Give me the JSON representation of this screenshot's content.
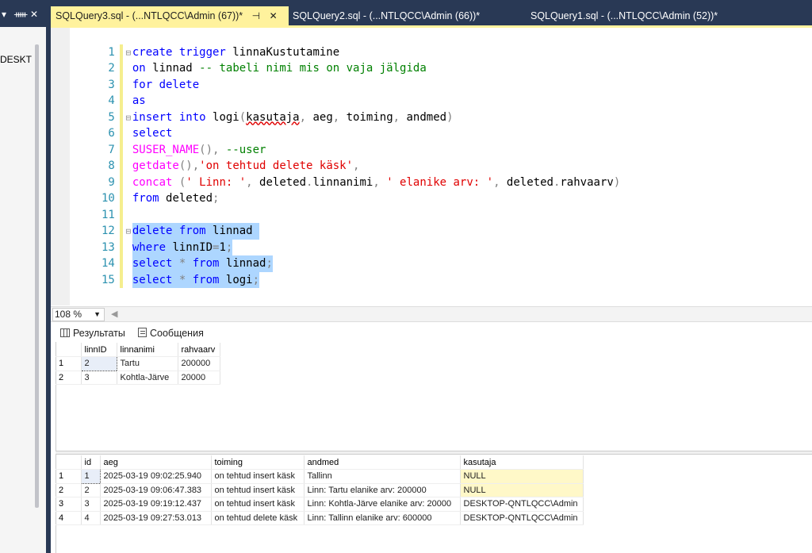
{
  "left_panel": {
    "header_icons": [
      "chevron-down",
      "pin",
      "close"
    ],
    "item": "DESKTO"
  },
  "tabs": [
    {
      "label": "SQLQuery3.sql - (...NTLQCC\\Admin (67))*",
      "active": true
    },
    {
      "label": "SQLQuery2.sql - (...NTLQCC\\Admin (66))*",
      "active": false
    },
    {
      "label": "SQLQuery1.sql - (...NTLQCC\\Admin (52))*",
      "active": false
    }
  ],
  "editor": {
    "lines": [
      {
        "n": "1",
        "fold": true,
        "text": "create trigger linnaKustutamine"
      },
      {
        "n": "2",
        "fold": false,
        "text": "on linnad -- tabeli nimi mis on vaja jälgida"
      },
      {
        "n": "3",
        "fold": false,
        "text": "for delete"
      },
      {
        "n": "4",
        "fold": false,
        "text": "as"
      },
      {
        "n": "5",
        "fold": true,
        "text": "insert into logi(kasutaja, aeg, toiming, andmed)"
      },
      {
        "n": "6",
        "fold": false,
        "text": "select"
      },
      {
        "n": "7",
        "fold": false,
        "text": "SUSER_NAME(), --user"
      },
      {
        "n": "8",
        "fold": false,
        "text": "getdate(),'on tehtud delete käsk',"
      },
      {
        "n": "9",
        "fold": false,
        "text": "concat (' Linn: ', deleted.linnanimi, ' elanike arv: ', deleted.rahvaarv)"
      },
      {
        "n": "10",
        "fold": false,
        "text": "from deleted;"
      },
      {
        "n": "11",
        "fold": false,
        "text": ""
      },
      {
        "n": "12",
        "fold": true,
        "text": "delete from linnad"
      },
      {
        "n": "13",
        "fold": false,
        "text": "where linnID=1;"
      },
      {
        "n": "14",
        "fold": false,
        "text": "select * from linnad;"
      },
      {
        "n": "15",
        "fold": false,
        "text": "select * from logi;"
      }
    ]
  },
  "zoom": {
    "value": "108 %"
  },
  "results_tabs": {
    "results": "Результаты",
    "messages": "Сообщения"
  },
  "grid1": {
    "columns": [
      "linnID",
      "linnanimi",
      "rahvaarv"
    ],
    "rows": [
      {
        "rn": "1",
        "cells": [
          "2",
          "Tartu",
          "200000"
        ]
      },
      {
        "rn": "2",
        "cells": [
          "3",
          "Kohtla-Järve",
          "20000"
        ]
      }
    ]
  },
  "grid2": {
    "columns": [
      "id",
      "aeg",
      "toiming",
      "andmed",
      "kasutaja"
    ],
    "rows": [
      {
        "rn": "1",
        "cells": [
          "1",
          "2025-03-19 09:02:25.940",
          "on tehtud insert käsk",
          "Tallinn",
          "NULL"
        ]
      },
      {
        "rn": "2",
        "cells": [
          "2",
          "2025-03-19 09:06:47.383",
          "on tehtud insert käsk",
          " Linn: Tartu elanike arv: 200000",
          "NULL"
        ]
      },
      {
        "rn": "3",
        "cells": [
          "3",
          "2025-03-19 09:19:12.437",
          "on tehtud insert käsk",
          " Linn: Kohtla-Järve elanike arv: 20000",
          "DESKTOP-QNTLQCC\\Admin"
        ]
      },
      {
        "rn": "4",
        "cells": [
          "4",
          "2025-03-19 09:27:53.013",
          "on tehtud delete käsk",
          " Linn: Tallinn elanike arv: 600000",
          "DESKTOP-QNTLQCC\\Admin"
        ]
      }
    ]
  },
  "colors": {
    "active_tab": "#fff29d",
    "chrome": "#293955",
    "selection": "#add6ff",
    "null_cell": "#fff8c8"
  }
}
